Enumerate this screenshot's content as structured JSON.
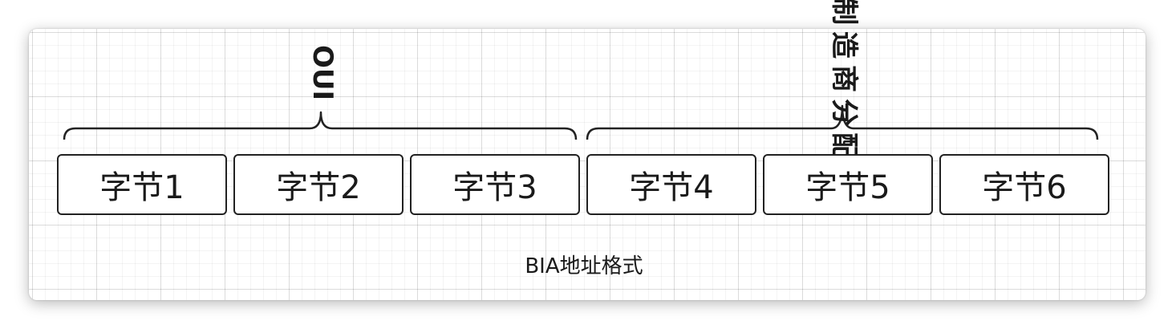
{
  "diagram": {
    "oui_label": "OUI",
    "vendor_label": "制造商分配",
    "bytes": [
      "字节1",
      "字节2",
      "字节3",
      "字节4",
      "字节5",
      "字节6"
    ],
    "caption": "BIA地址格式"
  }
}
